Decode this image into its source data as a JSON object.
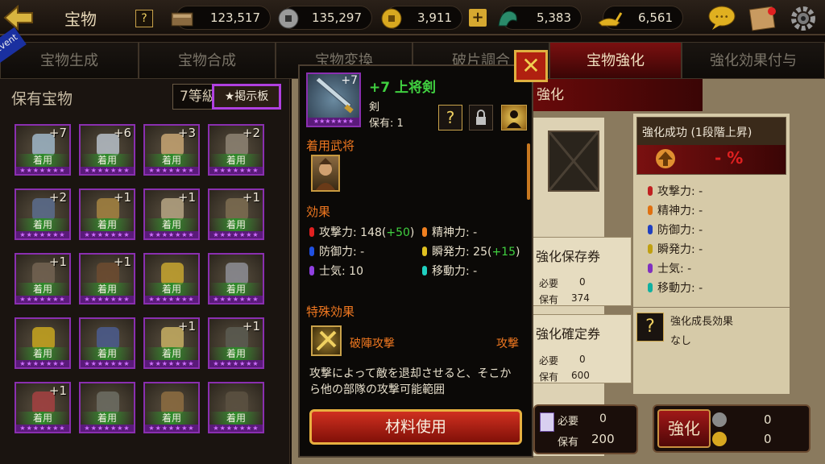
{
  "header": {
    "title": "宝物",
    "help": "?"
  },
  "resources": [
    {
      "icon": "book-icon",
      "value": "123,517"
    },
    {
      "icon": "silver-coin-icon",
      "value": "135,297"
    },
    {
      "icon": "gold-coin-icon",
      "value": "3,911"
    },
    {
      "icon": "jade-dragon-icon",
      "value": "5,383"
    },
    {
      "icon": "golden-lamp-icon",
      "value": "6,561"
    }
  ],
  "plus_label": "+",
  "tabs": [
    "宝物生成",
    "宝物合成",
    "宝物変換",
    "破片調合",
    "宝物強化",
    "強化効果付与"
  ],
  "event_label": "Event",
  "left_panel": {
    "title": "保有宝物",
    "filter": "7等級",
    "bbs_label": "★掲示板"
  },
  "items": [
    {
      "plus": "+7",
      "equip": "着用"
    },
    {
      "plus": "+6",
      "equip": "着用"
    },
    {
      "plus": "+3",
      "equip": "着用"
    },
    {
      "plus": "+2",
      "equip": "着用"
    },
    {
      "plus": "+2",
      "equip": "着用"
    },
    {
      "plus": "+1",
      "equip": "着用"
    },
    {
      "plus": "+1",
      "equip": "着用"
    },
    {
      "plus": "+1",
      "equip": "着用"
    },
    {
      "plus": "+1",
      "equip": "着用"
    },
    {
      "plus": "+1",
      "equip": "着用"
    },
    {
      "plus": "",
      "equip": "着用"
    },
    {
      "plus": "",
      "equip": "着用"
    },
    {
      "plus": "",
      "equip": "着用"
    },
    {
      "plus": "",
      "equip": "着用"
    },
    {
      "plus": "+1",
      "equip": "着用"
    },
    {
      "plus": "+1",
      "equip": "着用"
    },
    {
      "plus": "+1",
      "equip": "着用"
    },
    {
      "plus": "",
      "equip": "着用"
    },
    {
      "plus": "",
      "equip": "着用"
    },
    {
      "plus": "",
      "equip": "着用"
    }
  ],
  "popup": {
    "plus": "+7",
    "name": "+7 上将剣",
    "type": "剣",
    "owned": "保有: 1",
    "equip_general_label": "着用武将",
    "effect_label": "効果",
    "stats": [
      {
        "label": "攻撃力: 148(",
        "bonus": "+50",
        "tail": ")",
        "color": "#e02020"
      },
      {
        "label": "精神力: -",
        "bonus": "",
        "tail": "",
        "color": "#f08020"
      },
      {
        "label": "防御力: -",
        "bonus": "",
        "tail": "",
        "color": "#2050e0"
      },
      {
        "label": "瞬発力: 25(",
        "bonus": "+15",
        "tail": ")",
        "color": "#e0c020"
      },
      {
        "label": "士気:  10",
        "bonus": "",
        "tail": "",
        "color": "#9040e0"
      },
      {
        "label": "移動力: -",
        "bonus": "",
        "tail": "",
        "color": "#20d0c0"
      }
    ],
    "special_label": "特殊効果",
    "special_name": "破陣攻撃",
    "special_type": "攻撃",
    "special_desc": "攻撃によって敵を退却させると、そこから他の部隊の攻撃可能範囲",
    "material_button": "材料使用"
  },
  "right": {
    "enhance_label": "強化",
    "success_title": "強化成功 (1段階上昇)",
    "success_rate": "- %",
    "stats": [
      {
        "label": "攻撃力: -",
        "color": "#c02020"
      },
      {
        "label": "精神力: -",
        "color": "#e07010"
      },
      {
        "label": "防御力: -",
        "color": "#2040c0"
      },
      {
        "label": "瞬発力: -",
        "color": "#c0a010"
      },
      {
        "label": "士気: -",
        "color": "#8030c0"
      },
      {
        "label": "移動力: -",
        "color": "#10b0a0"
      }
    ],
    "growth_label": "強化成長効果",
    "growth_value": "なし",
    "save_ticket": "強化保存券",
    "confirm_ticket": "強化確定券",
    "need": "必要",
    "have": "保有",
    "save_need": "0",
    "save_have": "374",
    "confirm_need": "0",
    "confirm_have": "600",
    "mat_need": "0",
    "mat_have": "200",
    "strength_button": "強化",
    "cost1": "0",
    "cost2": "0"
  }
}
